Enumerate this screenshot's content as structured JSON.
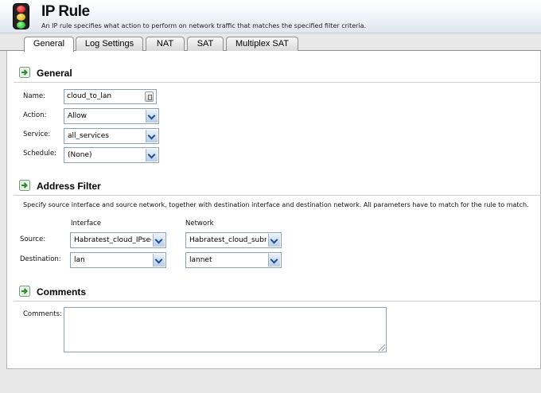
{
  "header": {
    "title": "IP Rule",
    "subtitle": "An IP rule specifies what action to perform on network traffic that matches the specified filter criteria."
  },
  "tabs": [
    {
      "label": "General",
      "active": true
    },
    {
      "label": "Log Settings",
      "active": false
    },
    {
      "label": "NAT",
      "active": false
    },
    {
      "label": "SAT",
      "active": false
    },
    {
      "label": "Multiplex SAT",
      "active": false
    }
  ],
  "general": {
    "heading": "General",
    "name_label": "Name:",
    "name_value": "cloud_to_lan",
    "action_label": "Action:",
    "action_value": "Allow",
    "service_label": "Service:",
    "service_value": "all_services",
    "schedule_label": "Schedule:",
    "schedule_value": "(None)"
  },
  "address_filter": {
    "heading": "Address Filter",
    "description": "Specify source interface and source network, together with destination interface and destination network. All parameters have to match for the rule to match.",
    "col_interface": "Interface",
    "col_network": "Network",
    "source_label": "Source:",
    "source_interface": "Habratest_cloud_IPsec",
    "source_network": "Habratest_cloud_subnet",
    "destination_label": "Destination:",
    "destination_interface": "lan",
    "destination_network": "lannet"
  },
  "comments": {
    "heading": "Comments",
    "label": "Comments:",
    "value": ""
  },
  "colors": {
    "accent": "#1f4f8f",
    "field_border": "#8da0b6",
    "section_icon": "#2e8b2e"
  }
}
